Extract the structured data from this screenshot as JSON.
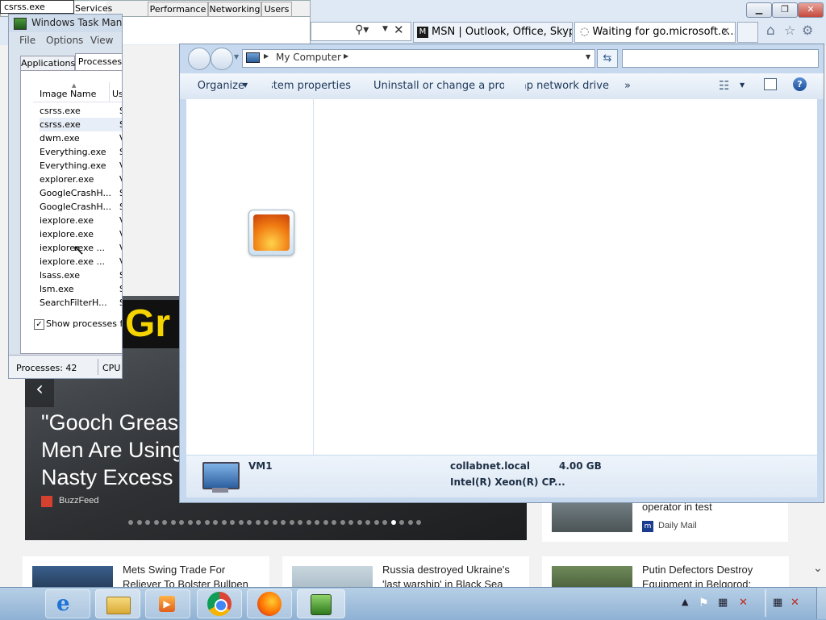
{
  "ie": {
    "tab_msn": "MSN | Outlook, Office, Skype, ...",
    "tab_waiting": "Waiting for go.microsoft.c...",
    "hero_title": "\"Gooch Grease\nMen Are Using\nNasty Excess C",
    "hero_source": "BuzzFeed",
    "hero_banner": "Gr",
    "right_card_text": "operator in test",
    "right_card_source": "Daily Mail",
    "card1_text": "Mets Swing Trade For\nReliever To Bolster Bullpen",
    "card2_text": "Russia destroyed Ukraine's\n'last warship' in Black Sea",
    "card3_text": "Putin Defectors Destroy\nEquipment in Belgorod:"
  },
  "taskmgr": {
    "title": "Windows Task Manager",
    "tooltip": "csrss.exe",
    "tabs": {
      "applications": "Applications",
      "processes": "Processes",
      "services": "Services",
      "performance": "Performance",
      "networking": "Networking",
      "users": "Users"
    },
    "menu": {
      "file": "File",
      "options": "Options",
      "view": "View"
    },
    "columns": {
      "image_name": "Image Name",
      "user": "Use"
    },
    "rows": [
      {
        "name": "csrss.exe",
        "user": "SY"
      },
      {
        "name": "csrss.exe",
        "user": "SY"
      },
      {
        "name": "dwm.exe",
        "user": "VM"
      },
      {
        "name": "Everything.exe",
        "user": "SY"
      },
      {
        "name": "Everything.exe",
        "user": "VM"
      },
      {
        "name": "explorer.exe",
        "user": "VM"
      },
      {
        "name": "GoogleCrashH...",
        "user": "SY"
      },
      {
        "name": "GoogleCrashH...",
        "user": "SY"
      },
      {
        "name": "iexplore.exe",
        "user": "VM"
      },
      {
        "name": "iexplore.exe",
        "user": "VM"
      },
      {
        "name": "iexplore.exe ...",
        "user": "VM"
      },
      {
        "name": "iexplore.exe ...",
        "user": "VM"
      },
      {
        "name": "lsass.exe",
        "user": "SY"
      },
      {
        "name": "lsm.exe",
        "user": "SY"
      },
      {
        "name": "SearchFilterH...",
        "user": "SY"
      }
    ],
    "show_all_label": "Show processes fro",
    "status_processes": "Processes: 42",
    "status_cpu": "CPU"
  },
  "explorer": {
    "breadcrumb": "My Computer",
    "commands": {
      "organize": "Organize",
      "system_properties": "System properties",
      "uninstall": "Uninstall or change a program",
      "map_drive": "Map network drive",
      "more": "»"
    },
    "computer_name": "VM1",
    "domain": "collabnet.local",
    "memory": "4.00 GB",
    "processor": "Intel(R) Xeon(R) CP..."
  }
}
